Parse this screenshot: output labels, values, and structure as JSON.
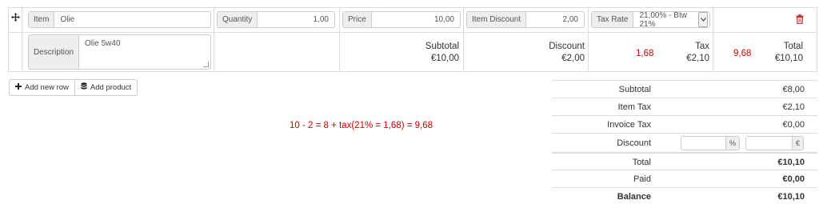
{
  "colors": {
    "accent_red": "#d40000",
    "border": "#dddddd",
    "addon_bg": "#eeeeee"
  },
  "icons": {
    "move": "move-arrows-icon",
    "delete": "trash-icon",
    "add_row": "plus-icon",
    "add_product": "database-icon"
  },
  "line_item": {
    "item_label": "Item",
    "item_value": "Olie",
    "quantity_label": "Quantity",
    "quantity_value": "1,00",
    "price_label": "Price",
    "price_value": "10,00",
    "discount_label": "Item Discount",
    "discount_value": "2,00",
    "tax_rate_label": "Tax Rate",
    "tax_rate_value": "21,00% - Btw 21%",
    "description_label": "Description",
    "description_value": "Olie 5w40",
    "subtotal_label": "Subtotal",
    "subtotal_value": "€10,00",
    "discount_total_label": "Discount",
    "discount_total_value": "€2,00",
    "tax_annotation": "1,68",
    "tax_label": "Tax",
    "tax_value": "€2,10",
    "total_annotation": "9,68",
    "total_label": "Total",
    "total_value": "€10,10"
  },
  "buttons": {
    "add_new_row": "Add new row",
    "add_product": "Add product"
  },
  "note": "10 - 2 = 8 + tax(21% = 1,68) = 9,68",
  "totals": {
    "subtotal_label": "Subtotal",
    "subtotal_value": "€8,00",
    "item_tax_label": "Item Tax",
    "item_tax_value": "€2,10",
    "invoice_tax_label": "Invoice Tax",
    "invoice_tax_value": "€0,00",
    "discount_label": "Discount",
    "discount_percent_addon": "%",
    "discount_amount_addon": "€",
    "total_label": "Total",
    "total_value": "€10,10",
    "paid_label": "Paid",
    "paid_value": "€0,00",
    "balance_label": "Balance",
    "balance_value": "€10,10"
  }
}
